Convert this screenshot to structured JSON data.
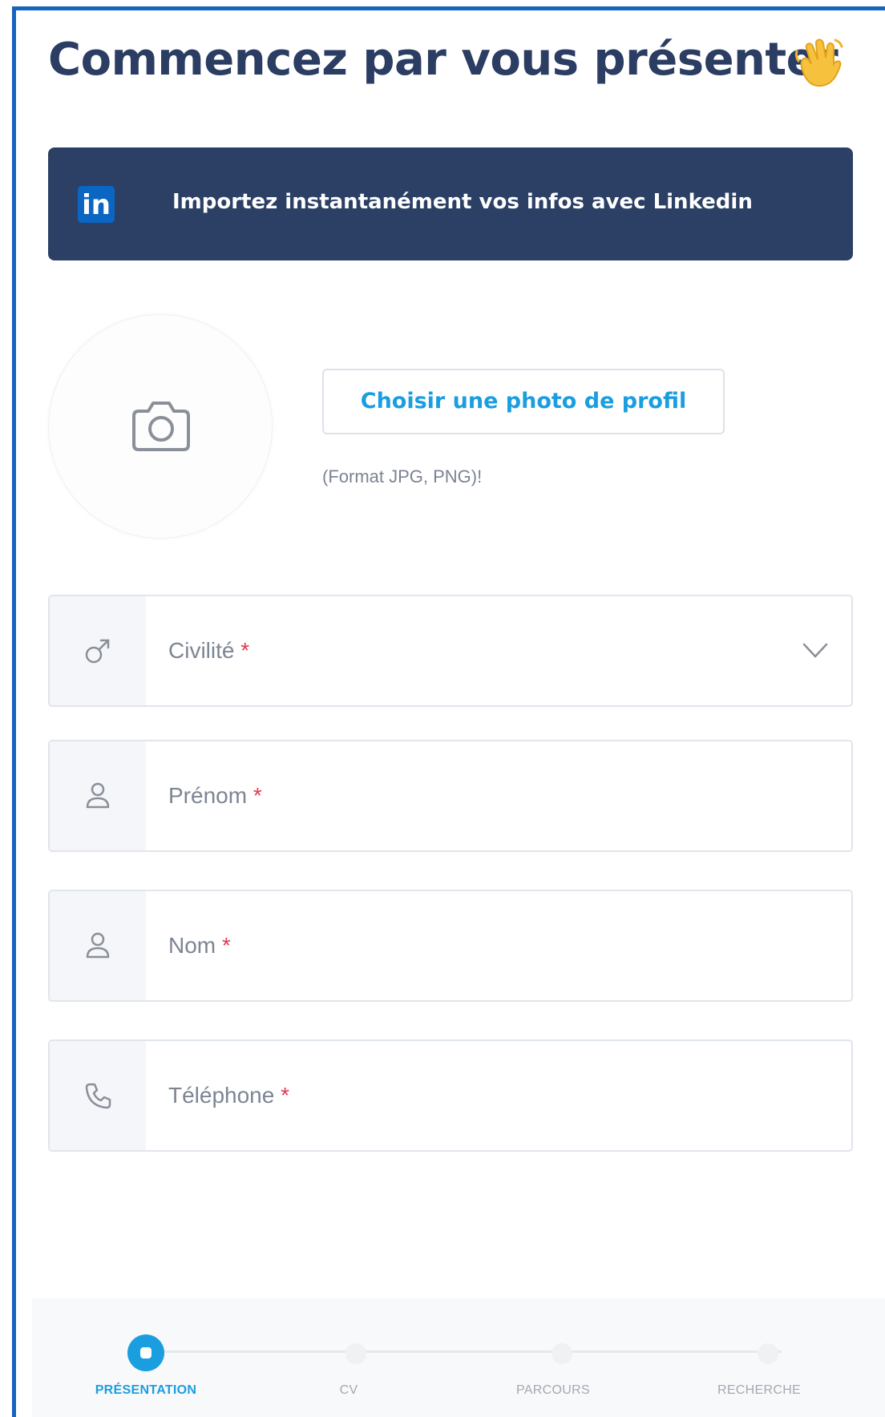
{
  "header": {
    "title": "Commencez par vous présenter"
  },
  "linkedin": {
    "icon_text": "in",
    "label": "Importez instantanément vos infos avec Linkedin"
  },
  "photo": {
    "button_label": "Choisir une photo de profil",
    "format_note": "(Format JPG, PNG)!"
  },
  "form": {
    "required_mark": "*",
    "fields": [
      {
        "label": "Civilité",
        "icon": "male-icon",
        "type": "select"
      },
      {
        "label": "Prénom",
        "icon": "user-icon",
        "type": "text"
      },
      {
        "label": "Nom",
        "icon": "user-icon",
        "type": "text"
      },
      {
        "label": "Téléphone",
        "icon": "phone-icon",
        "type": "tel"
      }
    ]
  },
  "steps": [
    {
      "label": "PRÉSENTATION",
      "active": true
    },
    {
      "label": "CV",
      "active": false
    },
    {
      "label": "PARCOURS",
      "active": false
    },
    {
      "label": "RECHERCHE",
      "active": false
    }
  ],
  "colors": {
    "title": "#2b3d63",
    "linkedin_banner": "#2c4066",
    "linkedin_brand": "#0a66c2",
    "accent": "#1a9ee0",
    "required": "#e53950",
    "frame_border": "#1565c0"
  }
}
